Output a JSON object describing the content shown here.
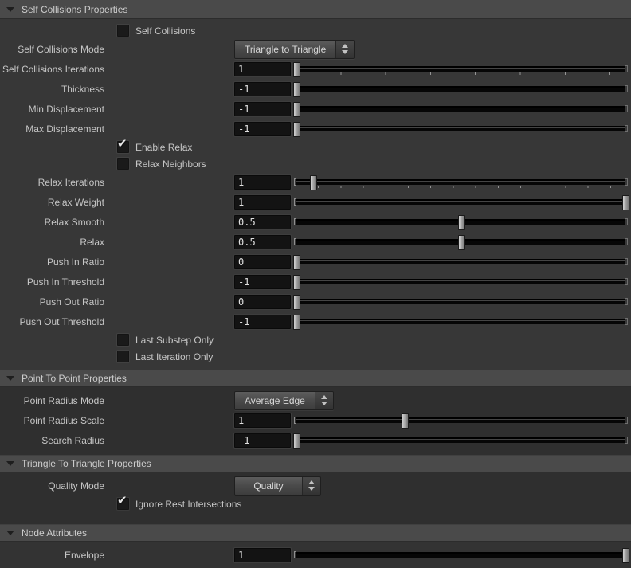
{
  "colors": {
    "accent_blue": "#2b66b3",
    "header_bg": "#4a4a4a",
    "content_bg": "#373737",
    "field_bg": "#131313",
    "text": "#c8c8c8"
  },
  "panel": {
    "sections": [
      {
        "title": "Self Collisions Properties",
        "rows": [
          {
            "type": "checkbox",
            "label": "Self Collisions",
            "checked": false
          },
          {
            "type": "dropdown",
            "label": "Self Collisions Mode",
            "value": "Triangle to Triangle"
          },
          {
            "type": "slider",
            "label": "Self Collisions Iterations",
            "value": "1",
            "fraction": 0,
            "ticks": "sparse"
          },
          {
            "type": "slider",
            "label": "Thickness",
            "value": "-1",
            "fraction": 0
          },
          {
            "type": "slider",
            "label": "Min Displacement",
            "value": "-1",
            "fraction": 0
          },
          {
            "type": "slider",
            "label": "Max Displacement",
            "value": "-1",
            "fraction": 0
          },
          {
            "type": "checkbox",
            "label": "Enable Relax",
            "checked": true
          },
          {
            "type": "checkbox",
            "label": "Relax Neighbors",
            "checked": false
          },
          {
            "type": "slider",
            "label": "Relax Iterations",
            "value": "1",
            "fraction": 0.05,
            "ticks": "dense"
          },
          {
            "type": "slider",
            "label": "Relax Weight",
            "value": "1",
            "fraction": 1
          },
          {
            "type": "slider",
            "label": "Relax Smooth",
            "value": "0.5",
            "fraction": 0.5
          },
          {
            "type": "slider",
            "label": "Relax",
            "value": "0.5",
            "fraction": 0.5
          },
          {
            "type": "slider",
            "label": "Push In Ratio",
            "value": "0",
            "fraction": 0
          },
          {
            "type": "slider",
            "label": "Push In Threshold",
            "value": "-1",
            "fraction": 0
          },
          {
            "type": "slider",
            "label": "Push Out Ratio",
            "value": "0",
            "fraction": 0
          },
          {
            "type": "slider",
            "label": "Push Out Threshold",
            "value": "-1",
            "fraction": 0
          },
          {
            "type": "checkbox",
            "label": "Last Substep Only",
            "checked": false
          },
          {
            "type": "checkbox",
            "label": "Last Iteration Only",
            "checked": false
          }
        ]
      },
      {
        "title": "Point To Point Properties",
        "rows": [
          {
            "type": "dropdown",
            "label": "Point Radius Mode",
            "value": "Average Edge"
          },
          {
            "type": "slider",
            "label": "Point Radius Scale",
            "value": "1",
            "fraction": 0.33
          },
          {
            "type": "slider",
            "label": "Search Radius",
            "value": "-1",
            "fraction": 0
          }
        ]
      },
      {
        "title": "Triangle To Triangle Properties",
        "rows": [
          {
            "type": "dropdown",
            "label": "Quality Mode",
            "value": "Quality"
          },
          {
            "type": "checkbox",
            "label": "Ignore Rest Intersections",
            "checked": true
          }
        ]
      },
      {
        "title": "Node Attributes",
        "rows": [
          {
            "type": "slider",
            "label": "Envelope",
            "value": "1",
            "fraction": 1
          }
        ]
      }
    ]
  }
}
